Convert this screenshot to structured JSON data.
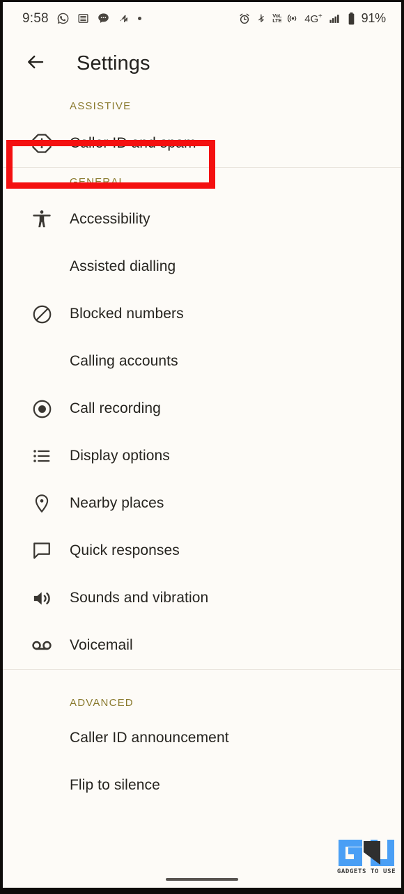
{
  "status_bar": {
    "time": "9:58",
    "left_icons": [
      {
        "name": "whatsapp-icon",
        "glyph": "whatsapp"
      },
      {
        "name": "news-icon",
        "glyph": "news"
      },
      {
        "name": "message-icon",
        "glyph": "message"
      },
      {
        "name": "swirl-icon",
        "glyph": "swirl"
      },
      {
        "name": "dot-icon",
        "glyph": "dot"
      }
    ],
    "right_icons": [
      {
        "name": "alarm-icon",
        "glyph": "alarm"
      },
      {
        "name": "bluetooth-icon",
        "glyph": "bluetooth"
      },
      {
        "name": "volte-icon",
        "glyph": "volte",
        "line1": "VoL",
        "line2": "LTE"
      },
      {
        "name": "hotspot-icon",
        "glyph": "hotspot"
      }
    ],
    "network_label": "4G",
    "network_sup": "+",
    "battery_percent": "91%"
  },
  "app_bar": {
    "back_icon": "arrow-back-icon",
    "title": "Settings"
  },
  "sections": [
    {
      "header": "ASSISTIVE",
      "items": [
        {
          "label": "Caller ID and spam",
          "icon": "report-spam-icon",
          "highlighted": true
        }
      ]
    },
    {
      "header": "GENERAL",
      "items": [
        {
          "label": "Accessibility",
          "icon": "accessibility-icon"
        },
        {
          "label": "Assisted dialling",
          "icon": "none"
        },
        {
          "label": "Blocked numbers",
          "icon": "block-icon"
        },
        {
          "label": "Calling accounts",
          "icon": "none"
        },
        {
          "label": "Call recording",
          "icon": "record-icon"
        },
        {
          "label": "Display options",
          "icon": "list-icon"
        },
        {
          "label": "Nearby places",
          "icon": "location-pin-icon"
        },
        {
          "label": "Quick responses",
          "icon": "chat-bubble-icon"
        },
        {
          "label": "Sounds and vibration",
          "icon": "volume-icon"
        },
        {
          "label": "Voicemail",
          "icon": "voicemail-icon"
        }
      ]
    },
    {
      "header": "ADVANCED",
      "items": [
        {
          "label": "Caller ID announcement",
          "icon": "none"
        },
        {
          "label": "Flip to silence",
          "icon": "none"
        }
      ]
    }
  ],
  "watermark": {
    "text": "GADGETS TO USE",
    "accent_color": "#4a9ff5"
  },
  "colors": {
    "background": "#fdfbf7",
    "section_header": "#8a7a2e",
    "highlight": "#f41010",
    "text": "#26241f"
  }
}
